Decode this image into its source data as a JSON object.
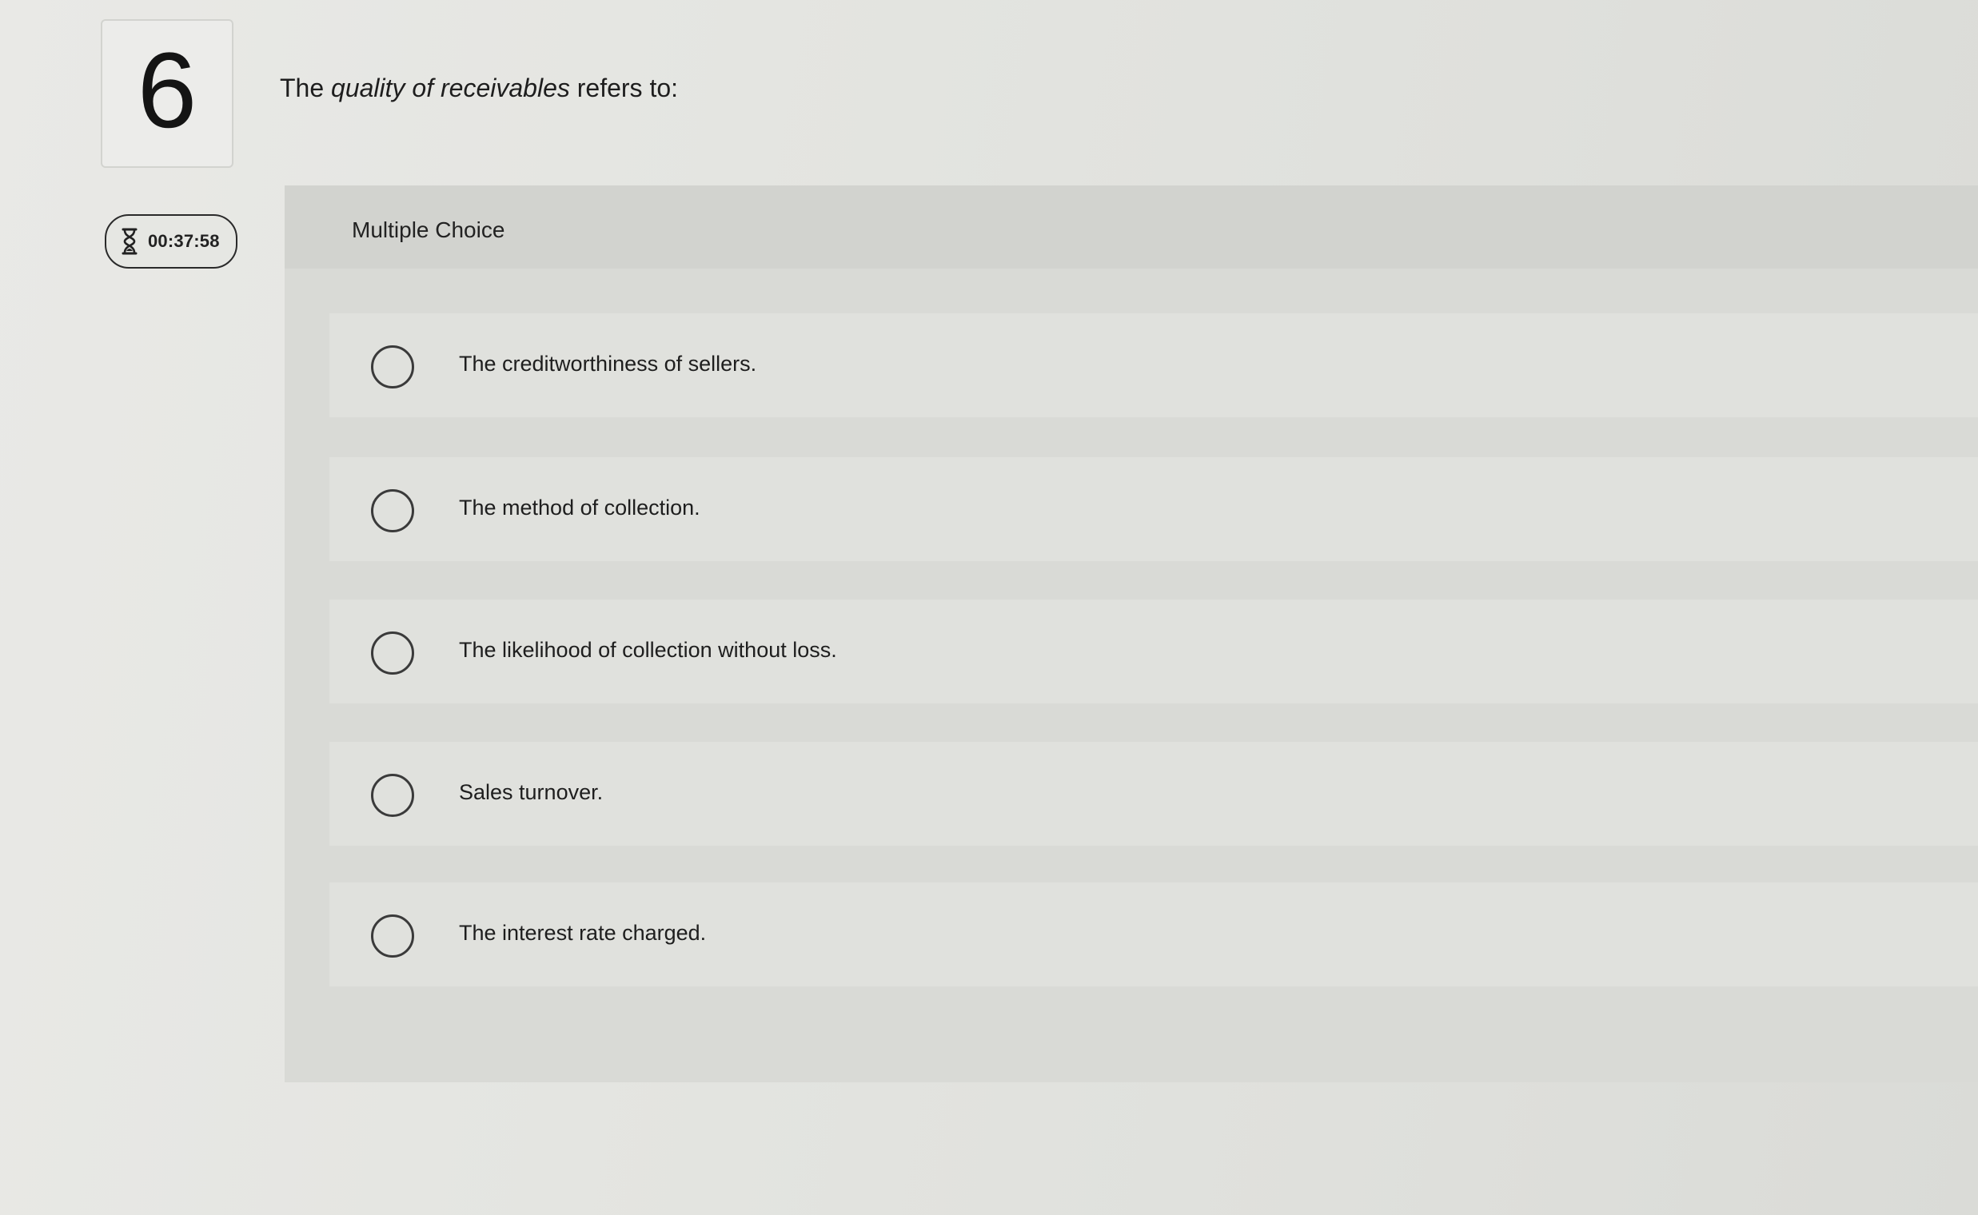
{
  "question": {
    "number": "6",
    "text_before": "The ",
    "text_emphasis": "quality of receivables",
    "text_after": " refers to:"
  },
  "timer": {
    "icon": "hourglass-icon",
    "value": "00:37:58"
  },
  "multiple_choice": {
    "label": "Multiple Choice",
    "options": [
      {
        "label": "The creditworthiness of sellers.",
        "selected": false
      },
      {
        "label": "The method of collection.",
        "selected": false
      },
      {
        "label": "The likelihood of collection without loss.",
        "selected": false
      },
      {
        "label": "Sales turnover.",
        "selected": false
      },
      {
        "label": "The interest rate charged.",
        "selected": false
      }
    ]
  }
}
